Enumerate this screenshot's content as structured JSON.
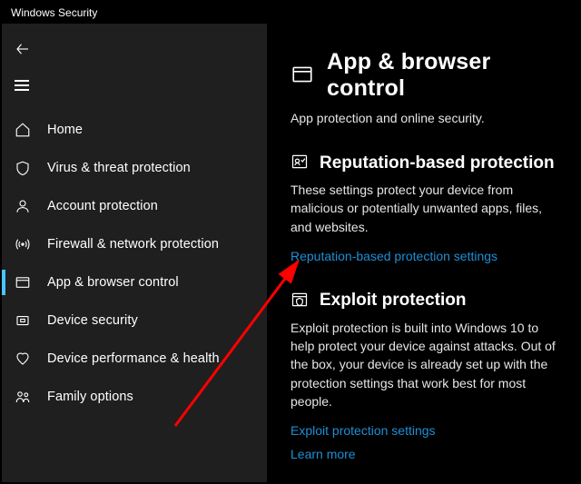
{
  "titlebar": {
    "title": "Windows Security"
  },
  "sidebar": {
    "items": [
      {
        "id": "home",
        "label": "Home"
      },
      {
        "id": "virus",
        "label": "Virus & threat protection"
      },
      {
        "id": "account",
        "label": "Account protection"
      },
      {
        "id": "firewall",
        "label": "Firewall & network protection"
      },
      {
        "id": "app",
        "label": "App & browser control"
      },
      {
        "id": "device",
        "label": "Device security"
      },
      {
        "id": "perf",
        "label": "Device performance & health"
      },
      {
        "id": "family",
        "label": "Family options"
      }
    ]
  },
  "page": {
    "title": "App & browser control",
    "subtitle": "App protection and online security."
  },
  "reputation": {
    "title": "Reputation-based protection",
    "body": "These settings protect your device from malicious or potentially unwanted apps, files, and websites.",
    "link": "Reputation-based protection settings"
  },
  "exploit": {
    "title": "Exploit protection",
    "body": "Exploit protection is built into Windows 10 to help protect your device against attacks.  Out of the box, your device is already set up with the protection settings that work best for most people.",
    "link1": "Exploit protection settings",
    "link2": "Learn more"
  }
}
